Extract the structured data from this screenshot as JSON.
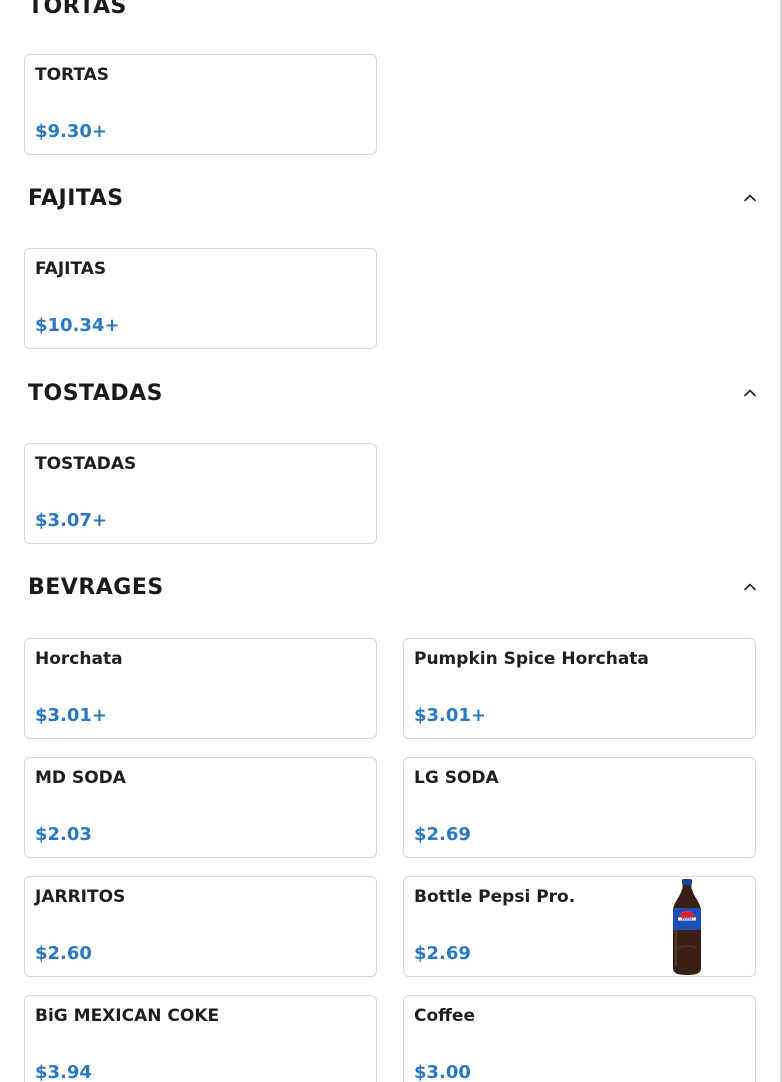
{
  "sections": [
    {
      "title": "TORTAS",
      "items": [
        {
          "name": "TORTAS",
          "price": "$9.30+"
        }
      ]
    },
    {
      "title": "FAJITAS",
      "items": [
        {
          "name": "FAJITAS",
          "price": "$10.34+"
        }
      ]
    },
    {
      "title": "TOSTADAS",
      "items": [
        {
          "name": "TOSTADAS",
          "price": "$3.07+"
        }
      ]
    },
    {
      "title": "BEVRAGES",
      "items": [
        {
          "name": "Horchata",
          "price": "$3.01+"
        },
        {
          "name": "Pumpkin Spice Horchata",
          "price": "$3.01+"
        },
        {
          "name": "MD SODA",
          "price": "$2.03"
        },
        {
          "name": "LG SODA",
          "price": "$2.69"
        },
        {
          "name": "JARRITOS",
          "price": "$2.60"
        },
        {
          "name": "Bottle Pepsi Pro.",
          "price": "$2.69",
          "thumbnail": "pepsi-bottle"
        },
        {
          "name": "BiG MEXICAN COKE",
          "price": "$3.94"
        },
        {
          "name": "Coffee",
          "price": "$3.00"
        }
      ]
    }
  ],
  "icons": {
    "collapse": "chevron-up-icon"
  },
  "colors": {
    "price": "#2a78c2",
    "text": "#1f1f1f",
    "border": "#d6d6d6"
  }
}
